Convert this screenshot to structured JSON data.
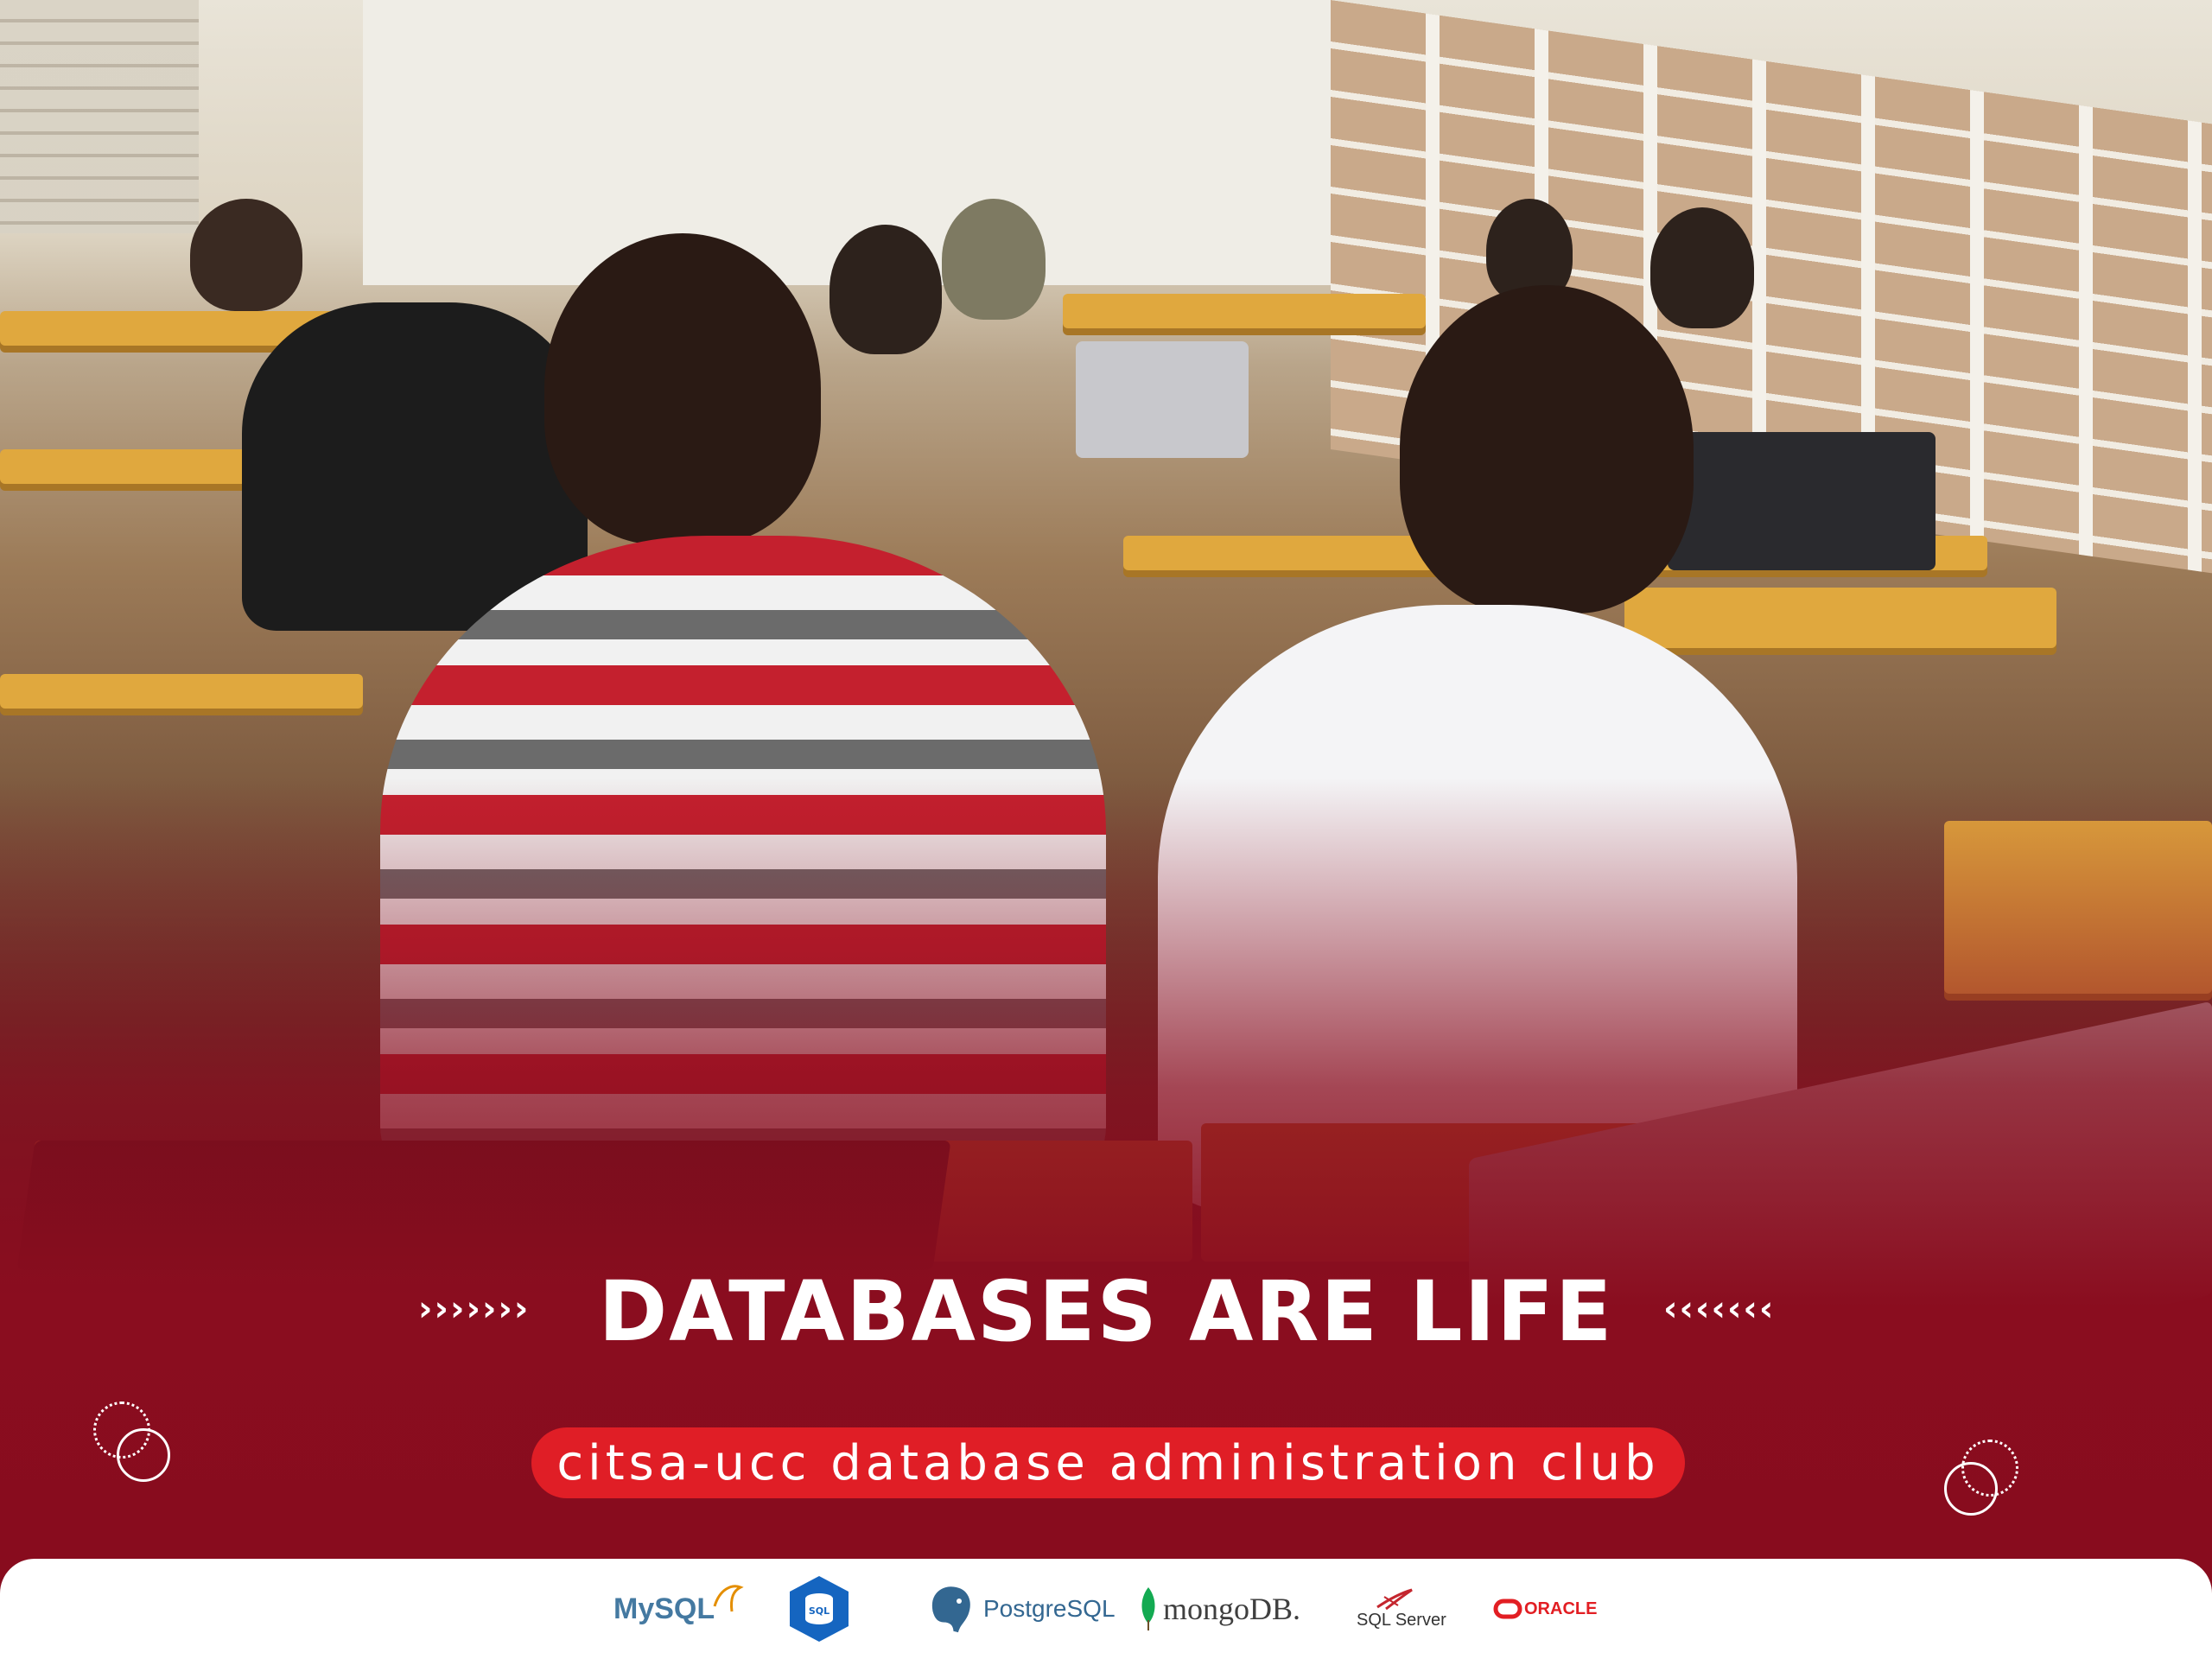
{
  "headline": "DATABASES ARE LIFE",
  "chevrons_left": "›››››››",
  "chevrons_right": "‹‹‹‹‹‹‹",
  "club_name": "citsa-ucc database administration club",
  "colors": {
    "brand_red": "#8a0d1f",
    "pill_red": "#e01e26",
    "white": "#ffffff"
  },
  "logos": [
    {
      "icon": "mysql-logo",
      "label": "MySQL"
    },
    {
      "icon": "sql-database-logo",
      "label": "SQL"
    },
    {
      "icon": "postgresql-logo",
      "label": "PostgreSQL"
    },
    {
      "icon": "mongodb-logo",
      "label": "mongoDB."
    },
    {
      "icon": "sql-server-logo",
      "label": "SQL Server"
    },
    {
      "icon": "oracle-logo",
      "label": "ORACLE"
    }
  ],
  "photo": {
    "icon": "classroom-photo"
  }
}
